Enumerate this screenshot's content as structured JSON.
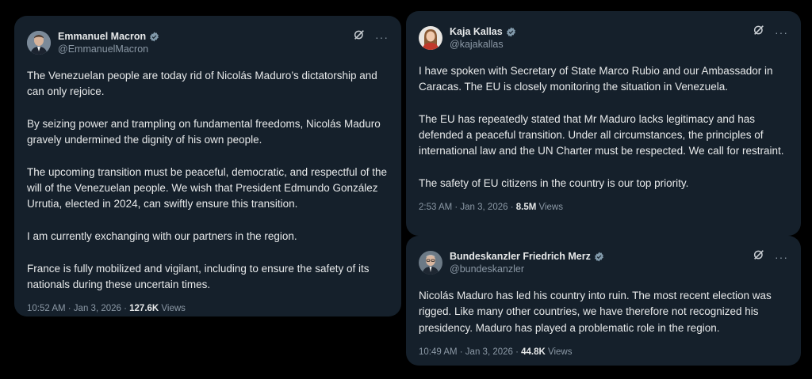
{
  "colors": {
    "background": "#000000",
    "card": "#15202b",
    "text": "#e7e9ea",
    "muted": "#8b98a5",
    "verified": "#829aab"
  },
  "posts": [
    {
      "name": "Emmanuel Macron",
      "handle": "@EmmanuelMacron",
      "paragraphs": [
        "The Venezuelan people are today rid of Nicolás Maduro’s dictatorship and can only rejoice.",
        "By seizing power and trampling on fundamental freedoms, Nicolás Maduro gravely undermined the dignity of his own people.",
        "The upcoming transition must be peaceful, democratic, and respectful of the will of the Venezuelan people. We wish that President Edmundo González Urrutia, elected in 2024, can swiftly ensure this transition.",
        "I am currently exchanging with our partners in the region.",
        "France is fully mobilized and vigilant, including to ensure the safety of its nationals during these uncertain times."
      ],
      "time": "10:52 AM · Jan 3, 2026 · ",
      "views": "127.6K",
      "views_label": " Views"
    },
    {
      "name": "Kaja Kallas",
      "handle": "@kajakallas",
      "paragraphs": [
        "I have spoken with Secretary of State Marco Rubio and our Ambassador in Caracas. The EU is closely monitoring the situation in Venezuela.",
        "The EU has repeatedly stated that Mr Maduro lacks legitimacy and has defended a peaceful transition. Under all circumstances, the principles of international law and the UN Charter must be respected. We call for restraint.",
        "The safety of EU citizens in the country is our top priority."
      ],
      "time": "2:53 AM · Jan 3, 2026 · ",
      "views": "8.5M",
      "views_label": " Views"
    },
    {
      "name": "Bundeskanzler Friedrich Merz",
      "handle": "@bundeskanzler",
      "paragraphs": [
        "Nicolás Maduro has led his country into ruin. The most recent election was rigged. Like many other countries, we have therefore not recognized his presidency. Maduro has played a problematic role in the region."
      ],
      "time": "10:49 AM · Jan 3, 2026 · ",
      "views": "44.8K",
      "views_label": " Views"
    }
  ],
  "icons": {
    "verified": "verified-badge-icon",
    "grok": "grok-icon",
    "more": "more-icon"
  },
  "more_glyph": "···"
}
